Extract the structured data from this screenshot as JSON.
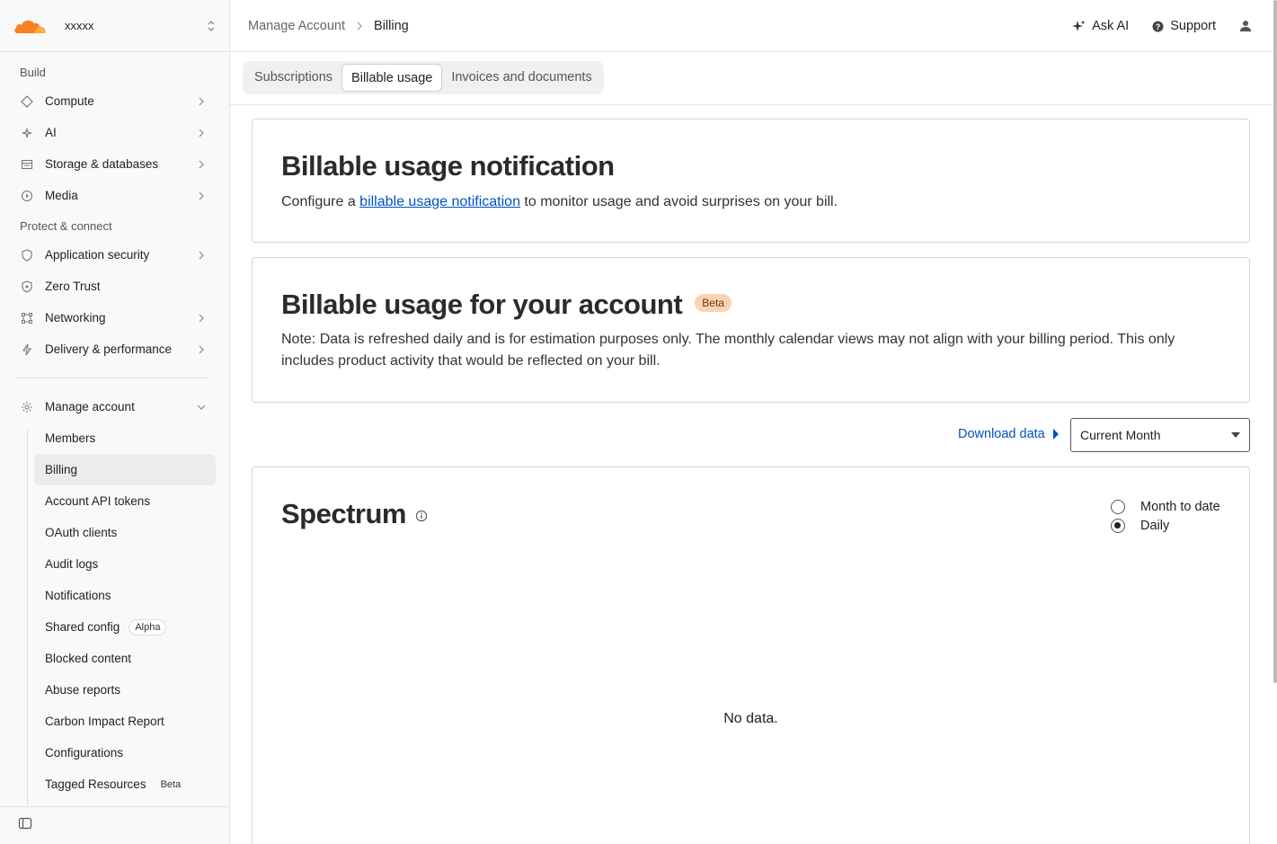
{
  "account": {
    "name": "xxxxx"
  },
  "sidebar": {
    "sections": [
      {
        "title": "Build",
        "items": [
          {
            "label": "Compute",
            "icon": "diamond-icon"
          },
          {
            "label": "AI",
            "icon": "sparkle-icon"
          },
          {
            "label": "Storage & databases",
            "icon": "database-icon"
          },
          {
            "label": "Media",
            "icon": "play-icon"
          }
        ]
      },
      {
        "title": "Protect & connect",
        "items": [
          {
            "label": "Application security",
            "icon": "shield-icon"
          },
          {
            "label": "Zero Trust",
            "icon": "lock-shield-icon"
          },
          {
            "label": "Networking",
            "icon": "network-icon"
          },
          {
            "label": "Delivery & performance",
            "icon": "bolt-icon"
          }
        ]
      }
    ],
    "manage": {
      "label": "Manage account",
      "items": [
        {
          "label": "Members"
        },
        {
          "label": "Billing"
        },
        {
          "label": "Account API tokens"
        },
        {
          "label": "OAuth clients"
        },
        {
          "label": "Audit logs"
        },
        {
          "label": "Notifications"
        },
        {
          "label": "Shared config",
          "badge": "Alpha"
        },
        {
          "label": "Blocked content"
        },
        {
          "label": "Abuse reports"
        },
        {
          "label": "Carbon Impact Report"
        },
        {
          "label": "Configurations"
        },
        {
          "label": "Tagged Resources",
          "badge": "Beta"
        }
      ]
    }
  },
  "breadcrumb": {
    "parent": "Manage Account",
    "current": "Billing"
  },
  "top": {
    "ask_ai": "Ask AI",
    "support": "Support"
  },
  "tabs": [
    {
      "label": "Subscriptions"
    },
    {
      "label": "Billable usage"
    },
    {
      "label": "Invoices and documents"
    }
  ],
  "notification_card": {
    "title": "Billable usage notification",
    "text_before": "Configure a ",
    "link": "billable usage notification",
    "text_after": " to monitor usage and avoid surprises on your bill."
  },
  "usage_card": {
    "title": "Billable usage for your account",
    "badge": "Beta",
    "note": "Note: Data is refreshed daily and is for estimation purposes only. The monthly calendar views may not align with your billing period. This only includes product activity that would be reflected on your bill."
  },
  "controls": {
    "download": "Download data",
    "period": "Current Month"
  },
  "spectrum": {
    "title": "Spectrum",
    "radios": [
      {
        "label": "Month to date",
        "checked": false
      },
      {
        "label": "Daily",
        "checked": true
      }
    ],
    "empty": "No data."
  }
}
